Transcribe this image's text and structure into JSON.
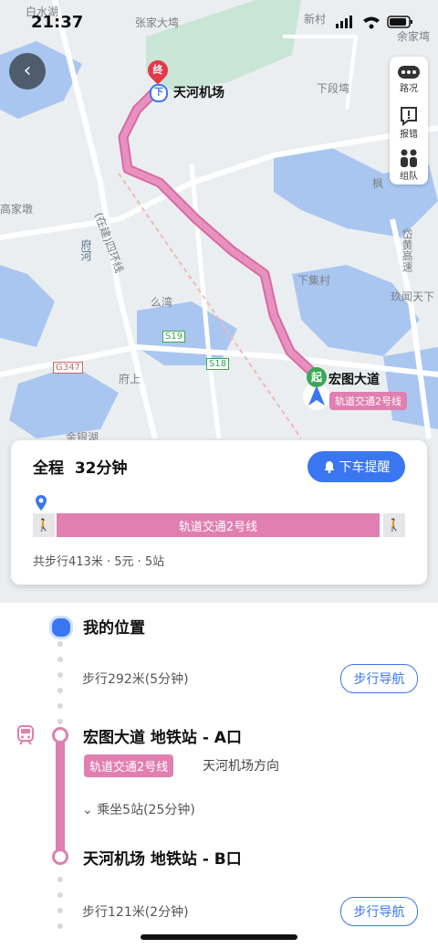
{
  "status_bar": {
    "time": "21:37"
  },
  "map": {
    "labels": {
      "baishui": "白水湖",
      "zhangjia": "张家大塆",
      "xincun": "新村",
      "yujiawan": "余家塆",
      "xiaduanwan": "下段塆",
      "fengshu": "枫",
      "gaojiadun": "高家墩",
      "fuhe": "府河",
      "huanxian": "(在建)四环线",
      "wan": "么湾",
      "xiajicun": "下集村",
      "gaoshu": "岱黄高速",
      "jiuwentian": "玖闻天下",
      "fushang": "府上",
      "jinyinhu": "金银湖",
      "s19": "S19",
      "s18": "S18",
      "g347": "G347"
    },
    "end_marker": "终",
    "alight_marker": "下",
    "end_station": "天河机场",
    "start_marker": "起",
    "start_station": "宏图大道",
    "line_pill": "轨道交通2号线"
  },
  "right_toolbar": {
    "traffic": "路况",
    "report": "报错",
    "team": "组队"
  },
  "summary_card": {
    "total_label": "全程",
    "total_time": "32分钟",
    "remind_button": "下车提醒",
    "bar_line": "轨道交通2号线",
    "details": "共步行413米 · 5元 · 5站"
  },
  "steps": {
    "my_location": "我的位置",
    "walk1": "步行292米(5分钟)",
    "walk_nav1": "步行导航",
    "board_station": "宏图大道 地铁站 - A口",
    "line_tag": "轨道交通2号线",
    "direction": "天河机场方向",
    "ride": "乘坐5站(25分钟)",
    "alight_station": "天河机场 地铁站 - B口",
    "walk2": "步行121米(2分钟)",
    "walk_nav2": "步行导航"
  },
  "colors": {
    "metro": "#e07fb0",
    "accent": "#3a76f0",
    "start_green": "#3aa757",
    "end_red": "#e5384a"
  }
}
